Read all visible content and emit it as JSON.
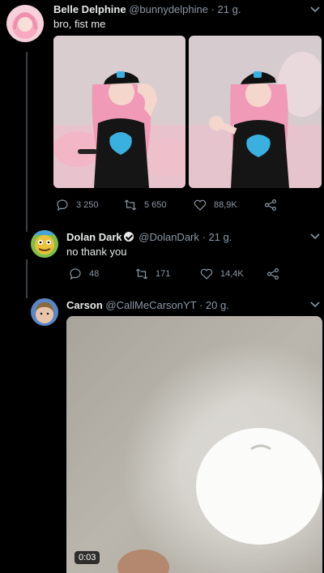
{
  "tweets": [
    {
      "name": "Belle Delphine",
      "handle": "@bunnydelphine",
      "time": "· 21 g.",
      "text": "bro, fist me",
      "actions": {
        "reply": "3 250",
        "retweet": "5 650",
        "like": "88,9K"
      }
    },
    {
      "name": "Dolan Dark",
      "handle": "@DolanDark",
      "time": "· 21 g.",
      "text": "no thank you",
      "actions": {
        "reply": "48",
        "retweet": "171",
        "like": "14,4K"
      }
    },
    {
      "name": "Carson",
      "handle": "@CallMeCarsonYT",
      "time": "· 20 g.",
      "video_time": "0:03"
    }
  ],
  "colors": {
    "background": "#000000",
    "muted": "#8b98a5",
    "text": "#e7e9ea",
    "thread": "#3a3f44"
  },
  "icons": [
    "reply-icon",
    "retweet-icon",
    "like-icon",
    "share-icon",
    "chevron-down-icon",
    "verified-icon"
  ]
}
